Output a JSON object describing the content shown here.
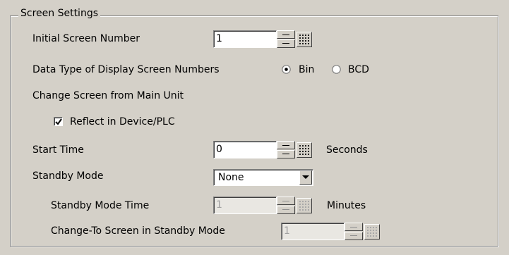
{
  "group": {
    "title": "Screen Settings"
  },
  "initial_screen": {
    "label": "Initial Screen Number",
    "value": "1"
  },
  "data_type": {
    "label": "Data Type of Display Screen Numbers",
    "options": [
      "Bin",
      "BCD"
    ],
    "selected": "Bin"
  },
  "change_screen": {
    "label": "Change Screen from Main Unit"
  },
  "reflect": {
    "label": "Reflect in Device/PLC",
    "checked": true
  },
  "start_time": {
    "label": "Start Time",
    "value": "0",
    "unit": "Seconds"
  },
  "standby_mode": {
    "label": "Standby Mode",
    "value": "None"
  },
  "standby_time": {
    "label": "Standby Mode Time",
    "value": "1",
    "unit": "Minutes",
    "enabled": false
  },
  "change_to_screen": {
    "label": "Change-To Screen in Standby Mode",
    "value": "1",
    "enabled": false
  },
  "icons": {
    "keypad": "keypad-icon",
    "spin": "spin-arrows-icon",
    "dropdown": "chevron-down-icon"
  }
}
